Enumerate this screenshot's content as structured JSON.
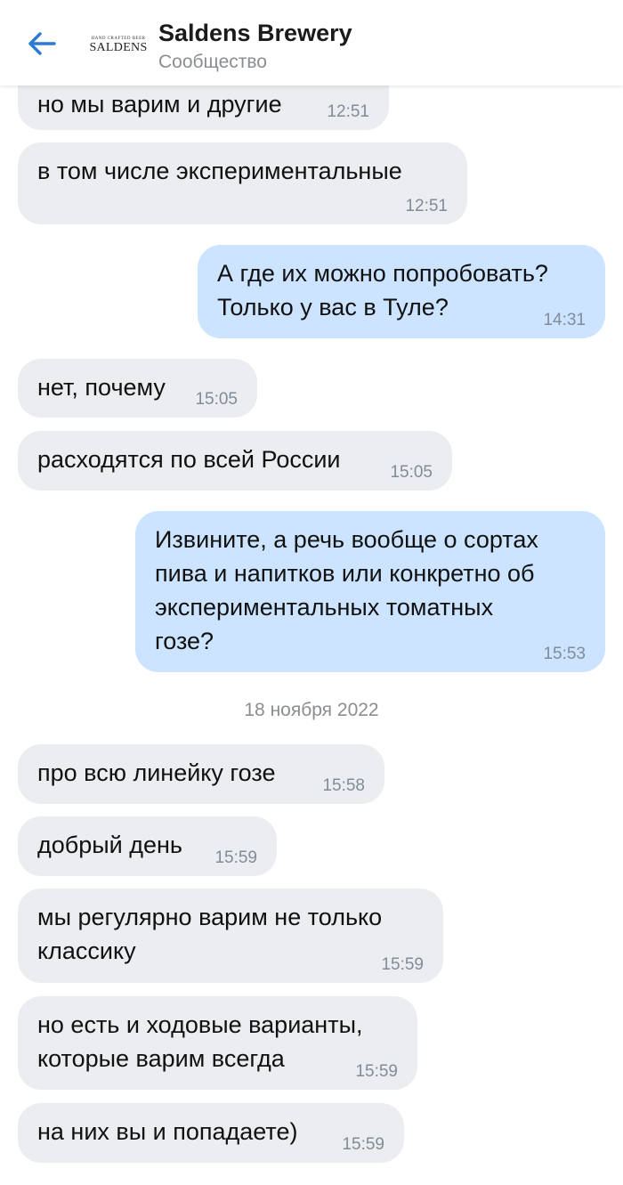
{
  "header": {
    "back_icon": "arrow-left-icon",
    "logo_top": "HAND CRAFTED BEER",
    "logo_text": "SALDENS",
    "title": "Saldens Brewery",
    "subtitle": "Сообщество",
    "accent_color": "#2a7ad6"
  },
  "messages": [
    {
      "dir": "in",
      "text": "но мы варим и другие",
      "time": "12:51"
    },
    {
      "dir": "in",
      "text": "в том числе экспериментальные",
      "time": "12:51"
    },
    {
      "dir": "out",
      "text": "А где их можно попробовать?\nТолько у вас в Туле?",
      "time": "14:31"
    },
    {
      "dir": "in",
      "text": "нет, почему",
      "time": "15:05"
    },
    {
      "dir": "in",
      "text": "расходятся по всей России",
      "time": "15:05"
    },
    {
      "dir": "out",
      "text": "Извините, а речь вообще о сортах\nпива и напитков или конкретно об\nэкспериментальных томатных\nгозе?",
      "time": "15:53"
    },
    {
      "dir": "in",
      "text": "про всю линейку гозе",
      "time": "15:58"
    },
    {
      "dir": "in",
      "text": "добрый день",
      "time": "15:59"
    },
    {
      "dir": "in",
      "text": "мы регулярно варим не только\nклассику",
      "time": "15:59"
    },
    {
      "dir": "in",
      "text": "но есть и ходовые варианты,\nкоторые варим всегда",
      "time": "15:59"
    },
    {
      "dir": "in",
      "text": "на них вы и попадаете)",
      "time": "15:59"
    }
  ],
  "date_separator": "18 ноября 2022",
  "colors": {
    "incoming_bubble": "#ebedf0",
    "outgoing_bubble": "#cce4ff",
    "time_text": "#818c99"
  }
}
